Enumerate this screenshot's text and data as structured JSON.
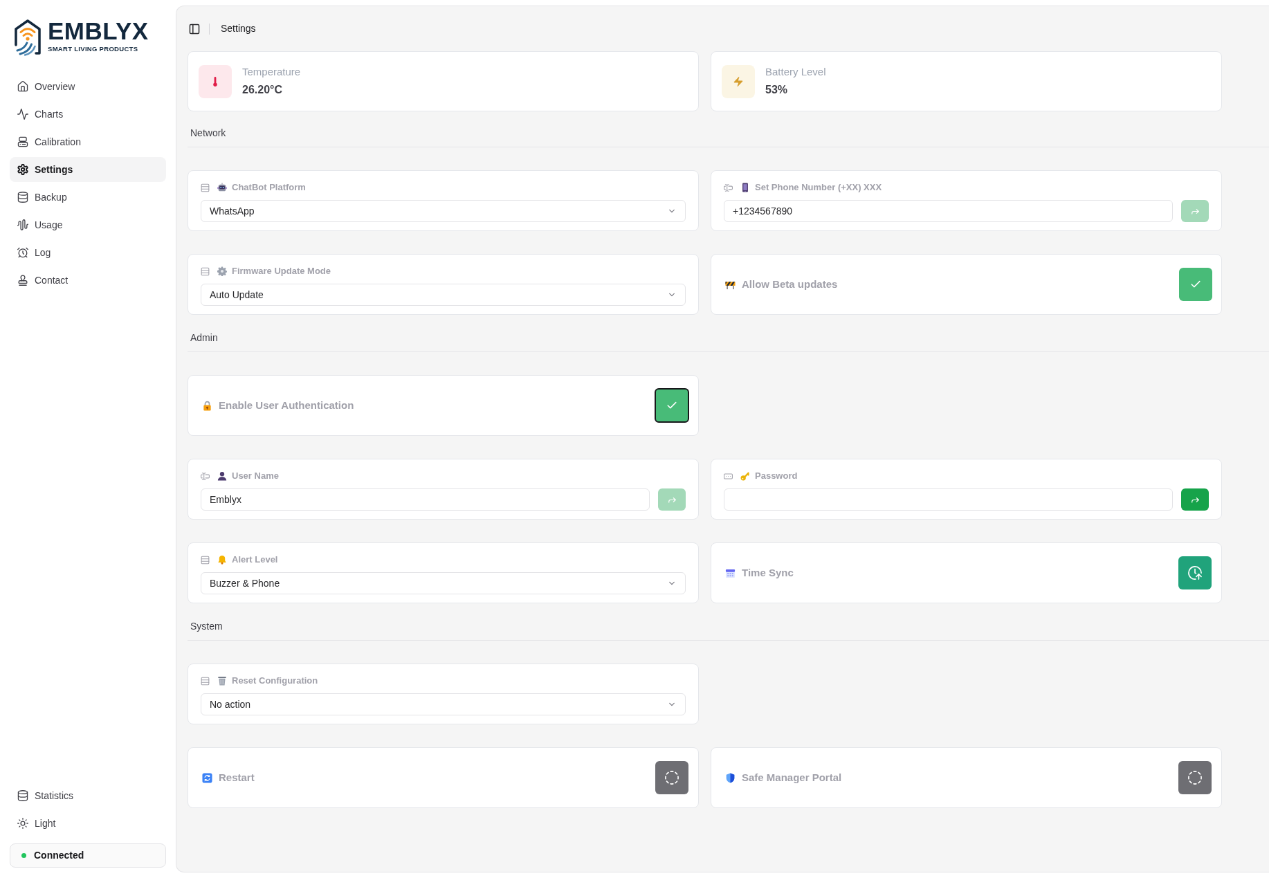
{
  "brand": {
    "name": "EMBLYX",
    "tagline": "SMART LIVING PRODUCTS"
  },
  "sidebar": {
    "items": [
      {
        "label": "Overview",
        "selected": false
      },
      {
        "label": "Charts",
        "selected": false
      },
      {
        "label": "Calibration",
        "selected": false
      },
      {
        "label": "Settings",
        "selected": true
      },
      {
        "label": "Backup",
        "selected": false
      },
      {
        "label": "Usage",
        "selected": false
      },
      {
        "label": "Log",
        "selected": false
      },
      {
        "label": "Contact",
        "selected": false
      }
    ],
    "footer_items": [
      {
        "label": "Statistics"
      },
      {
        "label": "Light"
      }
    ],
    "status": {
      "label": "Connected",
      "connected": true
    }
  },
  "header": {
    "title": "Settings"
  },
  "stats": [
    {
      "kind": "temperature",
      "label": "Temperature",
      "value": "26.20°C"
    },
    {
      "kind": "battery",
      "label": "Battery Level",
      "value": "53%"
    }
  ],
  "sections": [
    {
      "title": "Network",
      "rows": [
        [
          {
            "kind": "select",
            "label": "ChatBot Platform",
            "value": "WhatsApp"
          },
          {
            "kind": "text",
            "label": "Set Phone Number (+XX) XXX",
            "value": "+1234567890",
            "submit_enabled": false
          }
        ],
        [
          {
            "kind": "select",
            "label": "Firmware Update Mode",
            "value": "Auto Update"
          },
          {
            "kind": "checkbox",
            "label": "Allow Beta updates",
            "checked": true,
            "focused": false
          }
        ]
      ]
    },
    {
      "title": "Admin",
      "rows": [
        [
          {
            "kind": "checkbox",
            "label": "Enable User Authentication",
            "checked": true,
            "focused": true
          }
        ],
        [
          {
            "kind": "text",
            "label": "User Name",
            "value": "Emblyx",
            "submit_enabled": false
          },
          {
            "kind": "password",
            "label": "Password",
            "submit_enabled": true
          }
        ],
        [
          {
            "kind": "select",
            "label": "Alert Level",
            "value": "Buzzer & Phone"
          },
          {
            "kind": "action",
            "label": "Time Sync",
            "disabled": false
          }
        ]
      ]
    },
    {
      "title": "System",
      "rows": [
        [
          {
            "kind": "select",
            "label": "Reset Configuration",
            "value": "No action"
          }
        ],
        [
          {
            "kind": "action",
            "label": "Restart",
            "disabled": true
          },
          {
            "kind": "action",
            "label": "Safe Manager Portal",
            "disabled": true
          }
        ]
      ]
    }
  ]
}
